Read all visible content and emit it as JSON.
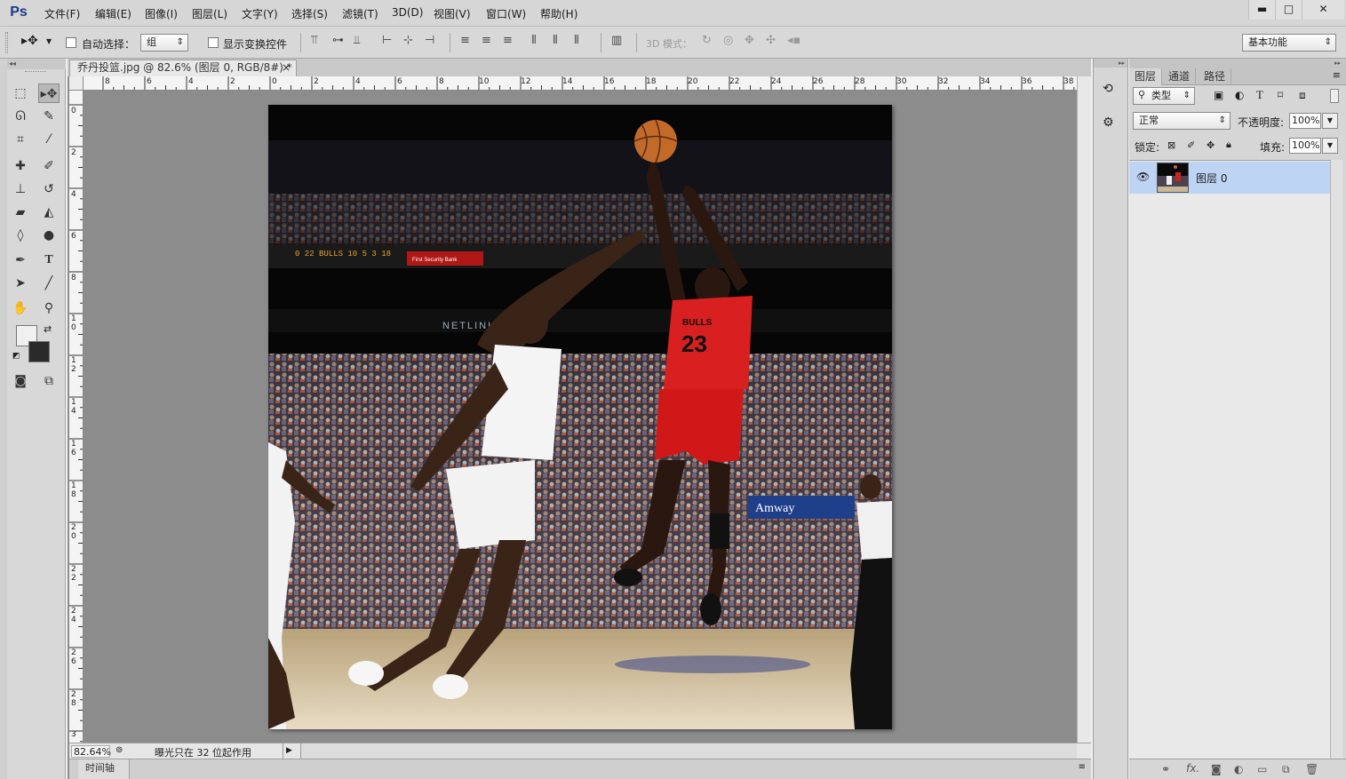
{
  "app": {
    "logo": "Ps"
  },
  "menu": [
    "文件(F)",
    "编辑(E)",
    "图像(I)",
    "图层(L)",
    "文字(Y)",
    "选择(S)",
    "滤镜(T)",
    "3D(D)",
    "视图(V)",
    "窗口(W)",
    "帮助(H)"
  ],
  "window_controls": {
    "minimize": "▬",
    "maximize": "□",
    "close": "✕"
  },
  "options": {
    "auto_select_label": "自动选择：",
    "auto_select_value": "组",
    "show_transform_label": "显示变换控件",
    "mode_3d_label": "3D 模式：",
    "workspace": "基本功能"
  },
  "document": {
    "tab_title": "乔丹投篮.jpg @ 82.6% (图层 0, RGB/8#) *",
    "tab_close": "×",
    "zoom": "82.64%",
    "status_text": "曝光只在 32 位起作用",
    "timeline_label": "时间轴"
  },
  "rulers": {
    "h": [
      "8",
      "6",
      "4",
      "2",
      "0",
      "2",
      "4",
      "6",
      "8",
      "10",
      "12",
      "14",
      "16",
      "18",
      "20",
      "22",
      "24",
      "26",
      "28",
      "30",
      "32",
      "34",
      "36",
      "38"
    ],
    "v": [
      "0",
      "2",
      "4",
      "6",
      "8",
      "10",
      "12",
      "14",
      "16",
      "18",
      "20",
      "22",
      "24",
      "26",
      "28",
      "3"
    ]
  },
  "layers_panel": {
    "tabs": [
      "图层",
      "通道",
      "路径"
    ],
    "filter_kind": "类型",
    "blend_mode": "正常",
    "opacity_label": "不透明度:",
    "opacity_value": "100%",
    "lock_label": "锁定:",
    "fill_label": "填充:",
    "fill_value": "100%",
    "layers": [
      {
        "name": "图层 0",
        "visible": true,
        "selected": true
      }
    ]
  },
  "photo": {
    "jersey_number": "23",
    "jersey_team": "BULLS",
    "sponsor": "Amway",
    "banner": "First Security Bank",
    "board": "NETLINK"
  },
  "colors": {
    "selection": "#bed4f5",
    "canvas_bg": "#8c8c8c",
    "ps_blue": "#1a3a8a"
  }
}
